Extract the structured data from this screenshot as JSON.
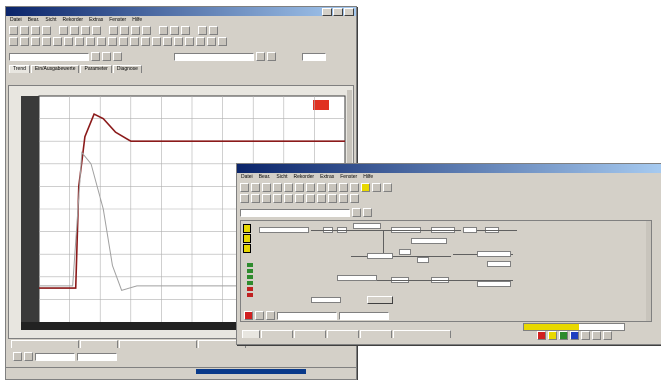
{
  "back_window": {
    "title": "",
    "menu": [
      "Datei",
      "Bear.",
      "Sicht",
      "Rekorder",
      "Extras",
      "Fenster",
      "Hilfe"
    ],
    "sub_tabs": [
      "Trend",
      "Ein/Ausgabewerte",
      "Parameter",
      "Diagnose"
    ],
    "bottom_tabs": [
      "",
      "",
      "",
      ""
    ],
    "status_text": "",
    "chart_tag": "",
    "colors": {
      "title": "#0a246a",
      "plot_bg": "#ffffff",
      "plot_border": "#3a3a3a",
      "grid": "#b0b0b0",
      "trace_main": "#8b1a1a",
      "trace_ref": "#a0a0a0",
      "axis_bar": "#222222",
      "tag": "#e03020"
    }
  },
  "front_window": {
    "title": "",
    "menu": [
      "Datei",
      "Bear.",
      "Sicht",
      "Rekorder",
      "Extras",
      "Fenster",
      "Hilfe"
    ],
    "tabs": [
      "",
      "",
      "",
      "",
      "",
      ""
    ],
    "status_text": "",
    "progress_fraction": 0.55,
    "colors": {
      "title_start": "#0a246a",
      "title_end": "#a6caf0",
      "accent_yellow": "#e8d800",
      "swatch_green": "#2e8b2e",
      "swatch_red": "#c02020",
      "led_red": "#d02020"
    }
  },
  "chart_data": {
    "type": "line",
    "title": "",
    "xlabel": "",
    "ylabel": "",
    "ylim": [
      0,
      100
    ],
    "xlim": [
      0,
      10
    ],
    "grid": true,
    "series": [
      {
        "x": [
          0,
          1.2,
          1.3,
          1.5,
          1.8,
          2.1,
          2.5,
          3,
          3.5,
          4,
          5,
          6,
          7,
          8,
          9,
          10
        ],
        "y": [
          15,
          15,
          60,
          82,
          92,
          90,
          84,
          80,
          80,
          80,
          80,
          80,
          80,
          80,
          80,
          80
        ]
      },
      {
        "x": [
          0,
          1.1,
          1.4,
          1.7,
          2.1,
          2.4,
          2.7,
          3.2,
          4,
          5,
          6,
          7,
          8,
          9,
          10
        ],
        "y": [
          16,
          16,
          75,
          70,
          50,
          25,
          14,
          16,
          16,
          16,
          16,
          16,
          16,
          16,
          16
        ]
      }
    ]
  }
}
